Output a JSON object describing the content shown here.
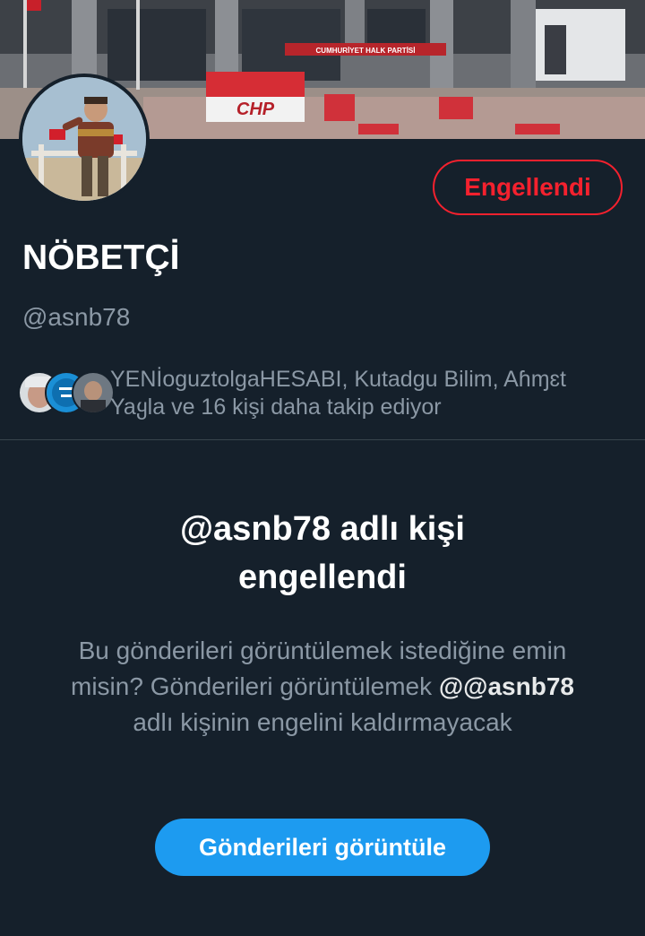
{
  "banner": {
    "sign_text": "CHP",
    "building_sign_text": "CUMHURİYET HALK PARTİSİ"
  },
  "profile": {
    "display_name": "NÖBETÇİ",
    "handle": "@asnb78",
    "blocked_button_label": "Engellendi",
    "followed_by_line1": "YENİoguztolgaHESABI, Kutadgu Bilim, Aɦɱɛt",
    "followed_by_line2": "Yaყla ve 16 kişi daha takip ediyor"
  },
  "blocked_notice": {
    "title_line1": "@asnb78 adlı kişi",
    "title_line2": "engellendi",
    "desc_part1": "Bu gönderileri görüntülemek istediğine emin misin? Gönderileri görüntülemek",
    "desc_handle": "@@asnb78",
    "desc_part2": "adlı kişinin engelini kaldırmayacak",
    "view_button_label": "Gönderileri görüntüle"
  },
  "colors": {
    "background": "#15202b",
    "blocked_red": "#f4212e",
    "primary_blue": "#1d9bf0",
    "secondary_text": "#8b98a5"
  }
}
